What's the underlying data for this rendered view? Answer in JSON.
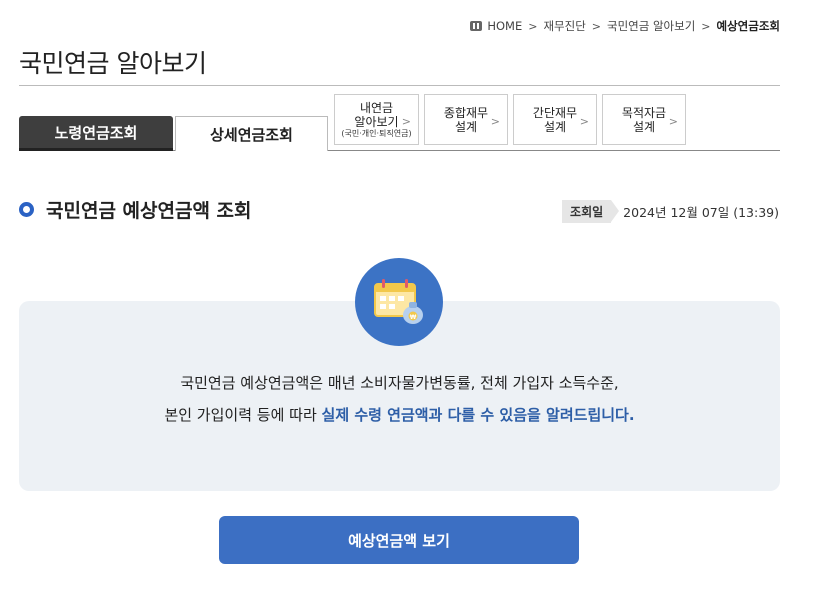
{
  "breadcrumb": {
    "home": "HOME",
    "items": [
      "재무진단",
      "국민연금 알아보기"
    ],
    "current": "예상연금조회"
  },
  "page_title": "국민연금 알아보기",
  "tabs": [
    {
      "label": "노령연금조회",
      "active": true
    },
    {
      "label": "상세연금조회",
      "active": false
    }
  ],
  "side_buttons": [
    {
      "label": "내연금\n알아보기",
      "sub": "(국민·개인·퇴직연금)"
    },
    {
      "label": "종합재무\n설계"
    },
    {
      "label": "간단재무\n설계"
    },
    {
      "label": "목적자금\n설계"
    }
  ],
  "section": {
    "title": "국민연금 예상연금액 조회",
    "query_label": "조회일",
    "query_date": "2024년 12월 07일 (13:39)"
  },
  "info": {
    "line1": "국민연금 예상연금액은 매년 소비자물가변동률, 전체 가입자 소득수준,",
    "line2_plain": "본인 가입이력 등에 따라 ",
    "line2_highlight": "실제 수령 연금액과 다를 수 있음을 알려드립니다.",
    "icon": "calendar-money-icon",
    "coin_mark": "₩"
  },
  "main_button": "예상연금액 보기",
  "colors": {
    "accent": "#3c6fc3",
    "highlight_text": "#2d5ea7",
    "active_tab": "#3e3e3e",
    "info_bg": "#edf1f5"
  }
}
